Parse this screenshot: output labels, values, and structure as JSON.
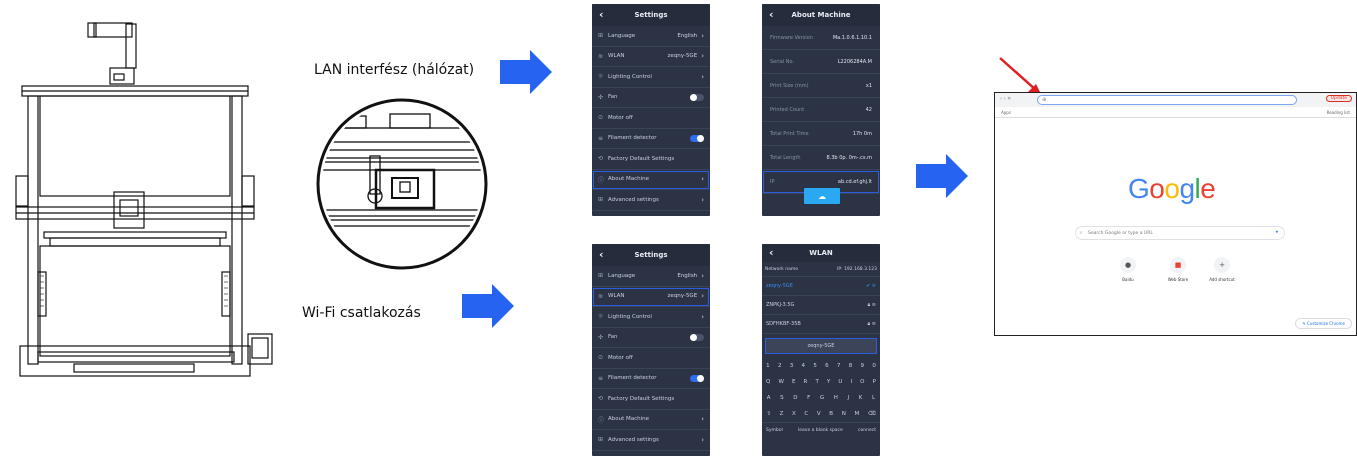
{
  "labels": {
    "lan": "LAN interfész (hálózat)",
    "wifi": "Wi-Fi csatlakozás"
  },
  "colors": {
    "arrow": "#2563f0",
    "screen_bg": "#2b3344",
    "highlight": "#2b5de0",
    "pointer": "#e02020"
  },
  "settings_screen": {
    "title": "Settings",
    "items": [
      {
        "icon": "language-icon",
        "name": "Language",
        "value": "English",
        "control": "chevron"
      },
      {
        "icon": "wifi-icon",
        "name": "WLAN",
        "value": "zeqny-5GE",
        "control": "chevron"
      },
      {
        "icon": "light-icon",
        "name": "Lighting Control",
        "value": "",
        "control": "chevron"
      },
      {
        "icon": "fan-icon",
        "name": "Fan",
        "value": "",
        "control": "toggle-off"
      },
      {
        "icon": "motor-icon",
        "name": "Motor off",
        "value": "",
        "control": "none"
      },
      {
        "icon": "filament-icon",
        "name": "Filament detector",
        "value": "",
        "control": "toggle-on"
      },
      {
        "icon": "reset-icon",
        "name": "Factory Default Settings",
        "value": "",
        "control": "none"
      },
      {
        "icon": "info-icon",
        "name": "About Machine",
        "value": "",
        "control": "chevron"
      },
      {
        "icon": "advanced-icon",
        "name": "Advanced settings",
        "value": "",
        "control": "chevron"
      }
    ]
  },
  "about_screen": {
    "title": "About Machine",
    "rows": [
      {
        "k": "Firmware Version",
        "v": "Ma.1.0.6.1.10.1"
      },
      {
        "k": "Serial No.",
        "v": "L2206284A.M"
      },
      {
        "k": "Print Size (mm)",
        "v": "x1"
      },
      {
        "k": "Printed Count",
        "v": "42"
      },
      {
        "k": "Total Print Time",
        "v": "17h 0m"
      },
      {
        "k": "Total Length",
        "v": "8.3b 0p. 0m-.cs.m"
      },
      {
        "k": "IP",
        "v": "ab.cd.ef.ghj.lt"
      }
    ],
    "update_icon": "upload-icon"
  },
  "wlan_screen": {
    "title": "WLAN",
    "network_label": "Network name",
    "ip_label": "IP: 192.168.3.123",
    "networks": [
      {
        "name": "zeqny-5GE",
        "selected": true
      },
      {
        "name": "ZNPKJ-3.5G",
        "selected": false
      },
      {
        "name": "SDFHKBF-35B",
        "selected": false
      }
    ],
    "password": "zeqny-5GE",
    "keyboard": [
      [
        "1",
        "2",
        "3",
        "4",
        "5",
        "6",
        "7",
        "8",
        "9",
        "0"
      ],
      [
        "Q",
        "W",
        "E",
        "R",
        "T",
        "Y",
        "U",
        "I",
        "O",
        "P"
      ],
      [
        "A",
        "S",
        "D",
        "F",
        "G",
        "H",
        "J",
        "K",
        "L"
      ],
      [
        "⇧",
        "Z",
        "X",
        "C",
        "V",
        "B",
        "N",
        "M",
        "⌫"
      ]
    ],
    "kb_bottom": [
      "Symbol",
      "leave a blank space",
      "connect"
    ]
  },
  "browser": {
    "address_placeholder": "⊕",
    "bookmark_left": "Apps",
    "bookmark_right": "Reading list",
    "logo_letters": [
      {
        "ch": "G",
        "color": "#4285f4"
      },
      {
        "ch": "o",
        "color": "#ea4335"
      },
      {
        "ch": "o",
        "color": "#fbbc05"
      },
      {
        "ch": "g",
        "color": "#4285f4"
      },
      {
        "ch": "l",
        "color": "#34a853"
      },
      {
        "ch": "e",
        "color": "#ea4335"
      }
    ],
    "search_placeholder": "Search Google or type a URL",
    "shortcuts": [
      "Baidu",
      "Web Store",
      "Add shortcut"
    ],
    "customize": "Customize Chrome",
    "update_btn": "Update"
  }
}
